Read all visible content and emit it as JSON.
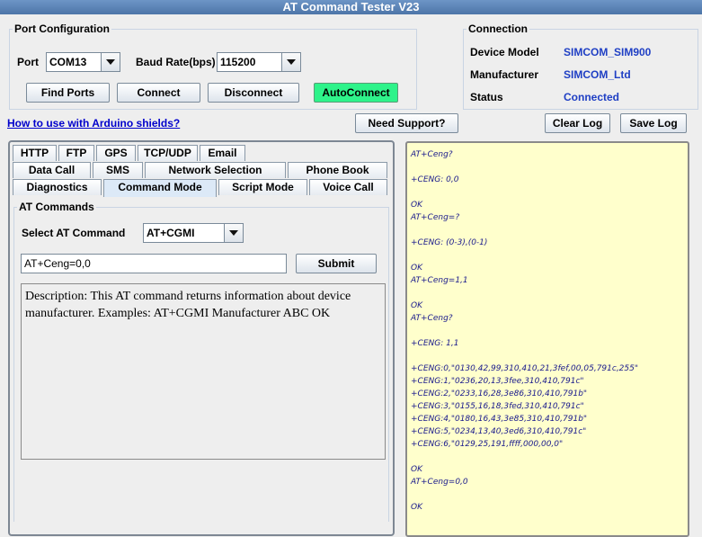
{
  "window": {
    "title": "AT Command Tester V23"
  },
  "port_config": {
    "title": "Port Configuration",
    "port_label": "Port",
    "port_value": "COM13",
    "baud_label": "Baud Rate(bps)",
    "baud_value": "115200",
    "buttons": {
      "find_ports": "Find Ports",
      "connect": "Connect",
      "disconnect": "Disconnect",
      "autoconnect": "AutoConnect"
    }
  },
  "connection": {
    "title": "Connection",
    "device_model_label": "Device Model",
    "device_model_value": "SIMCOM_SIM900",
    "manufacturer_label": "Manufacturer",
    "manufacturer_value": "SIMCOM_Ltd",
    "status_label": "Status",
    "status_value": "Connected"
  },
  "toolbar": {
    "help_link": "How to use with Arduino shields?",
    "need_support": "Need Support?",
    "clear_log": "Clear Log",
    "save_log": "Save Log"
  },
  "tabs": {
    "row1": [
      "HTTP",
      "FTP",
      "GPS",
      "TCP/UDP",
      "Email"
    ],
    "row2": [
      "Data Call",
      "SMS",
      "Network Selection",
      "Phone Book"
    ],
    "row3": [
      "Diagnostics",
      "Command Mode",
      "Script Mode",
      "Voice Call"
    ],
    "active": "Command Mode"
  },
  "at_commands": {
    "title": "AT Commands",
    "select_label": "Select AT Command",
    "select_value": "AT+CGMI",
    "input_value": "AT+Ceng=0,0",
    "submit": "Submit",
    "description": "Description: This AT command returns information about device manufacturer. Examples: AT+CGMI Manufacturer ABC OK"
  },
  "log": [
    "AT+Ceng?",
    "",
    "+CENG: 0,0",
    "",
    "OK",
    "AT+Ceng=?",
    "",
    "+CENG: (0-3),(0-1)",
    "",
    "OK",
    "AT+Ceng=1,1",
    "",
    "OK",
    "AT+Ceng?",
    "",
    "+CENG: 1,1",
    "",
    "+CENG:0,\"0130,42,99,310,410,21,3fef,00,05,791c,255\"",
    "+CENG:1,\"0236,20,13,3fee,310,410,791c\"",
    "+CENG:2,\"0233,16,28,3e86,310,410,791b\"",
    "+CENG:3,\"0155,16,18,3fed,310,410,791c\"",
    "+CENG:4,\"0180,16,43,3e85,310,410,791b\"",
    "+CENG:5,\"0234,13,40,3ed6,310,410,791c\"",
    "+CENG:6,\"0129,25,191,ffff,000,00,0\"",
    "",
    "OK",
    "AT+Ceng=0,0",
    "",
    "OK"
  ]
}
